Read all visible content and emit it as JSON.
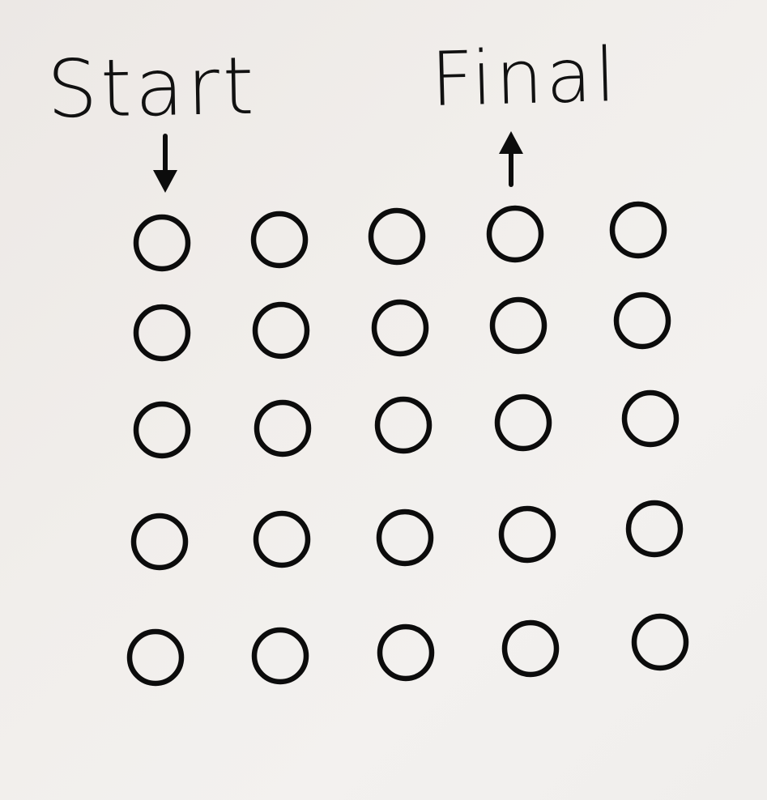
{
  "labels": {
    "start": "Start",
    "final": "Final"
  },
  "grid": {
    "rows": 5,
    "columns": 5
  },
  "markers": {
    "start_column": 1,
    "start_arrow": "down-arrow-icon",
    "final_column": 4,
    "final_arrow": "up-arrow-icon"
  },
  "colors": {
    "ink": "#0c0c0c",
    "paper": "#f0eeeb"
  }
}
